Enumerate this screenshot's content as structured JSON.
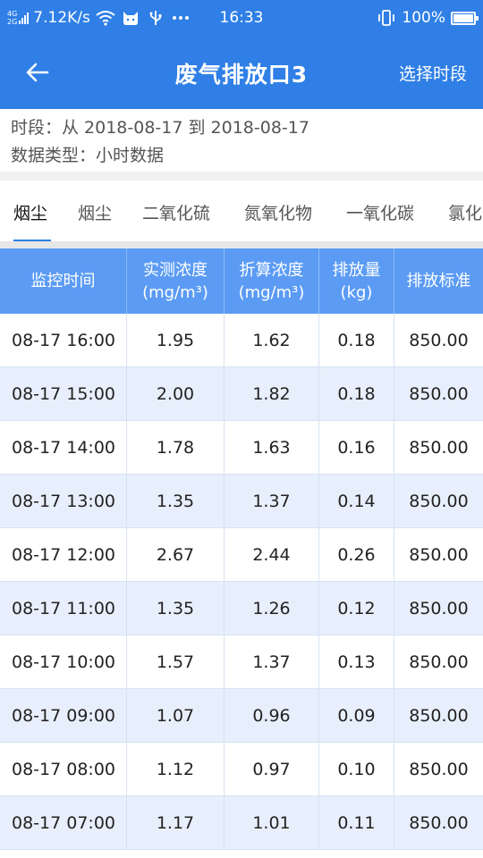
{
  "status_bar": {
    "net_top": "4G",
    "net_bottom": "2G",
    "speed": "7.12K/s",
    "time": "16:33",
    "battery": "100%",
    "icons": [
      "signal-icon",
      "wifi-icon",
      "cat-icon",
      "usb-icon",
      "more-icon",
      "vibrate-icon",
      "battery-icon"
    ]
  },
  "header": {
    "title": "废气排放口3",
    "back_icon": "arrow-left-icon",
    "select_period": "选择时段"
  },
  "info": {
    "period": "时段：从 2018-08-17 到 2018-08-17",
    "data_type": "数据类型：小时数据"
  },
  "tabs": [
    {
      "label": "烟尘",
      "active": true
    },
    {
      "label": "烟尘",
      "active": false
    },
    {
      "label": "二氧化硫",
      "active": false
    },
    {
      "label": "氮氧化物",
      "active": false
    },
    {
      "label": "一氧化碳",
      "active": false
    },
    {
      "label": "氯化",
      "active": false
    }
  ],
  "table": {
    "columns": [
      {
        "line1": "监控时间",
        "line2": ""
      },
      {
        "line1": "实测浓度",
        "line2": "(mg/m³)"
      },
      {
        "line1": "折算浓度",
        "line2": "(mg/m³)"
      },
      {
        "line1": "排放量",
        "line2": "(kg)"
      },
      {
        "line1": "排放标准",
        "line2": ""
      }
    ],
    "rows": [
      [
        "08-17 16:00",
        "1.95",
        "1.62",
        "0.18",
        "850.00"
      ],
      [
        "08-17 15:00",
        "2.00",
        "1.82",
        "0.18",
        "850.00"
      ],
      [
        "08-17 14:00",
        "1.78",
        "1.63",
        "0.16",
        "850.00"
      ],
      [
        "08-17 13:00",
        "1.35",
        "1.37",
        "0.14",
        "850.00"
      ],
      [
        "08-17 12:00",
        "2.67",
        "2.44",
        "0.26",
        "850.00"
      ],
      [
        "08-17 11:00",
        "1.35",
        "1.26",
        "0.12",
        "850.00"
      ],
      [
        "08-17 10:00",
        "1.57",
        "1.37",
        "0.13",
        "850.00"
      ],
      [
        "08-17 09:00",
        "1.07",
        "0.96",
        "0.09",
        "850.00"
      ],
      [
        "08-17 08:00",
        "1.12",
        "0.97",
        "0.10",
        "850.00"
      ],
      [
        "08-17 07:00",
        "1.17",
        "1.01",
        "0.11",
        "850.00"
      ]
    ]
  },
  "colors": {
    "primary": "#2f7fe6",
    "table_header": "#5b9bf4",
    "row_alt": "#e8effc"
  }
}
